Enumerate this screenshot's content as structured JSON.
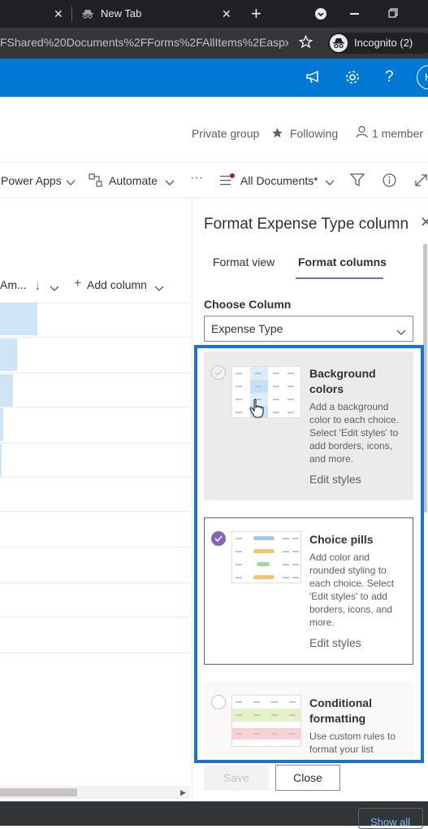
{
  "browser": {
    "tab_inactive_close": "✕",
    "tab_new_label": "New Tab",
    "url_text": "FShared%20Documents%2FForms%2FAllItems%2Easpx...",
    "incognito_label": "Incognito (2)",
    "new_tab_plus": "+",
    "show_all": "Show all"
  },
  "suite": {
    "avatar_initial": "H"
  },
  "site_header": {
    "privacy": "Private group",
    "following": "Following",
    "members": "1 member"
  },
  "command_bar": {
    "power_apps": "Power Apps",
    "automate": "Automate",
    "more": "···",
    "view_name": "All Documents*"
  },
  "list": {
    "amount_header": "Am...",
    "add_column": "Add column",
    "bar_fill_fractions": [
      1.0,
      0.45,
      0.35,
      0.08,
      0.04
    ]
  },
  "panel": {
    "title": "Format Expense Type column",
    "tabs": [
      {
        "label": "Format view",
        "selected": false
      },
      {
        "label": "Format columns",
        "selected": true
      }
    ],
    "choose_column_label": "Choose Column",
    "choose_column_value": "Expense Type",
    "options": [
      {
        "title": "Background colors",
        "description": "Add a background color to each choice. Select 'Edit styles' to add borders, icons, and more.",
        "link": "Edit styles",
        "selected": false
      },
      {
        "title": "Choice pills",
        "description": "Add color and rounded styling to each choice. Select 'Edit styles' to add borders, icons, and more.",
        "link": "Edit styles",
        "selected": true
      },
      {
        "title": "Conditional formatting",
        "description": "Use custom rules to format your list",
        "link": "",
        "selected": false
      }
    ],
    "save_label": "Save",
    "close_label": "Close"
  },
  "colors": {
    "brand_blue": "#0078d4",
    "highlight_blue": "#1a73d0",
    "selected_radio": "#8764b8",
    "bar_fill": "#cfe4f6"
  }
}
